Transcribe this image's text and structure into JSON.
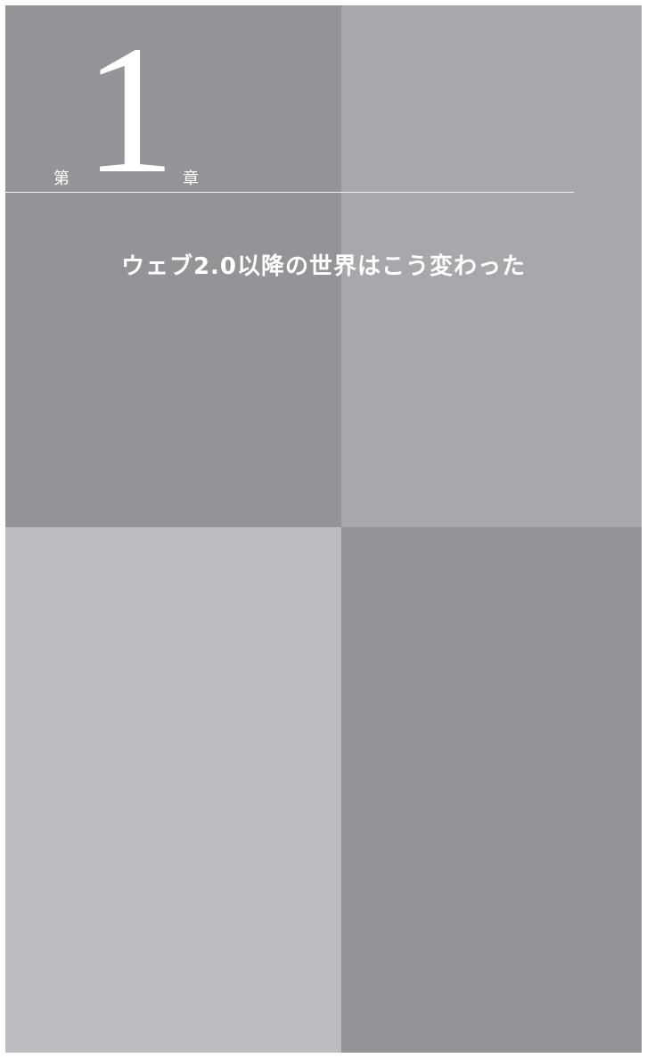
{
  "chapter": {
    "prefix": "第",
    "number": "1",
    "suffix": "章",
    "title": "ウェブ2.0以降の世界はこう変わった"
  },
  "colors": {
    "dark_gray": "#939498",
    "mid_gray": "#a7a8ac",
    "light_gray": "#bbbcbf",
    "text": "#ffffff"
  }
}
